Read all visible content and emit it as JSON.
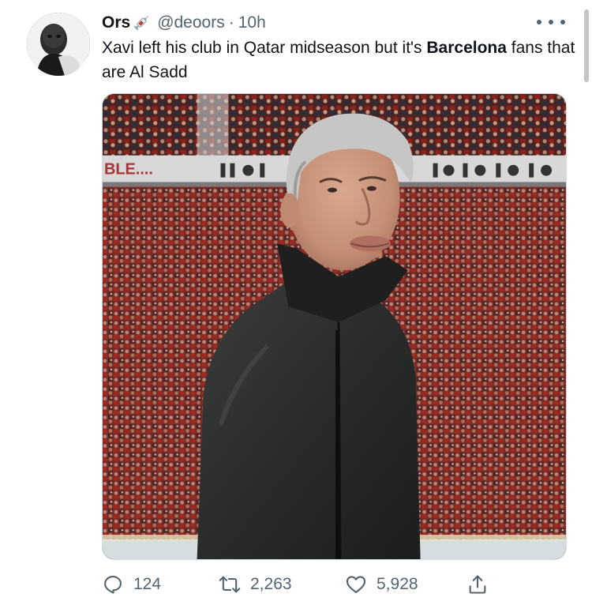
{
  "tweet": {
    "author_name": "Ors",
    "name_emoji": "syringe-emoji",
    "handle": "@deoors",
    "separator": "·",
    "time": "10h",
    "text_part1": "Xavi left his club in Qatar midseason but it's ",
    "text_bold": "Barcelona",
    "text_part2": " fans that are Al Sadd",
    "media_description_icon": "photo-mourinho-stadium",
    "stadium_sign_left": "BLE....",
    "stats": {
      "replies": "124",
      "retweets": "2,263",
      "likes": "5,928"
    },
    "icons": {
      "reply": "reply-icon",
      "retweet": "retweet-icon",
      "like": "heart-icon",
      "share": "share-icon",
      "more": "more-icon"
    },
    "colors": {
      "text": "#0f1419",
      "secondary": "#536471",
      "border": "#cfd9de"
    }
  }
}
